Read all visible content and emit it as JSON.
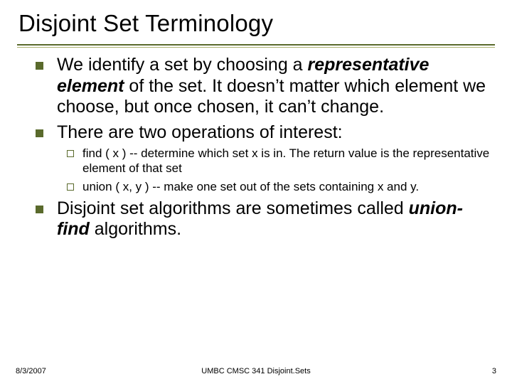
{
  "title": "Disjoint Set Terminology",
  "bullets": {
    "b1_pre": "We identify a set by choosing a ",
    "b1_em": "representative element",
    "b1_post": " of the set. It doesn’t matter which element we choose, but once chosen, it can’t change.",
    "b2": "There are two operations of interest:",
    "s1": "find ( x ) -- determine which set x is in. The return value is the representative element of that set",
    "s2": "union ( x, y ) -- make one set out of the sets containing x and y.",
    "b3_pre": "Disjoint set algorithms are sometimes called ",
    "b3_em": "union-find",
    "b3_post": " algorithms."
  },
  "footer": {
    "date": "8/3/2007",
    "source": "UMBC CMSC 341 Disjoint.Sets",
    "page": "3"
  }
}
